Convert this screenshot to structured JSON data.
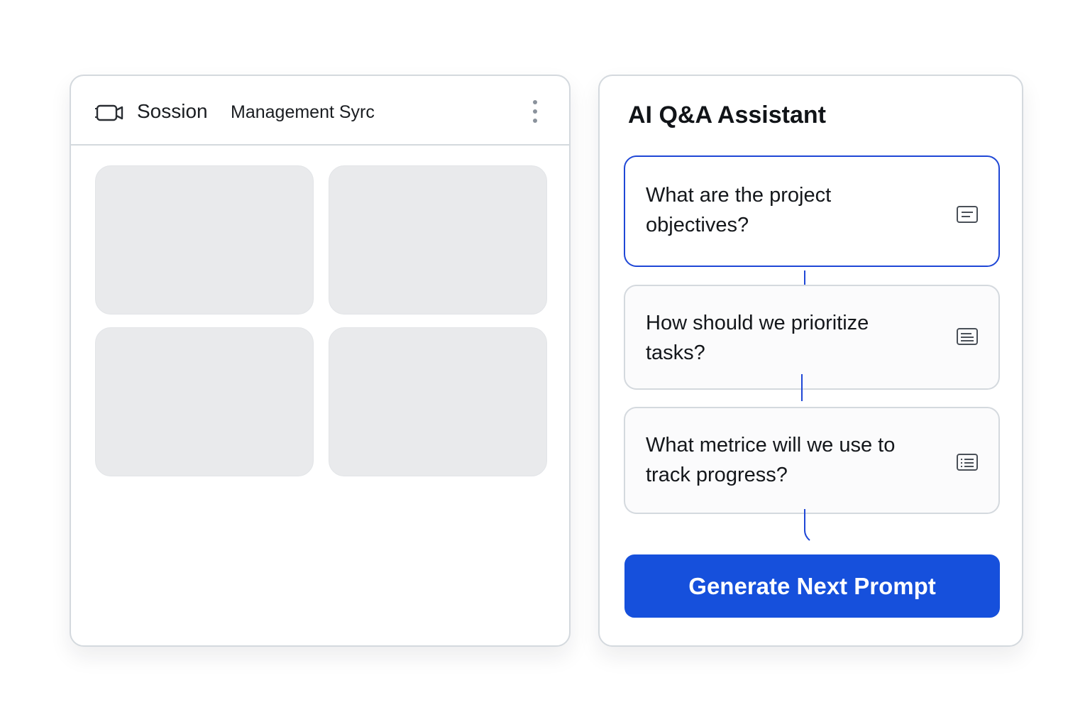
{
  "meeting": {
    "title": "Sossion",
    "subtitle": "Management Syrc",
    "tiles": 4
  },
  "assistant": {
    "title": "AI Q&A Assistant",
    "questions": [
      {
        "text": "What are the project objectives?",
        "active": true
      },
      {
        "text": "How should we prioritize tasks?",
        "active": false
      },
      {
        "text": "What metrice will we use to track progress?",
        "active": false
      }
    ],
    "generate_label": "Generate Next Prompt"
  },
  "icons": {
    "camera": "video-camera-icon",
    "more": "more-vertical-icon",
    "question": "list-icon"
  },
  "colors": {
    "accent": "#1650dc",
    "active_border": "#1f47d6",
    "tile": "#e9eaec",
    "border": "#d4d9de"
  }
}
